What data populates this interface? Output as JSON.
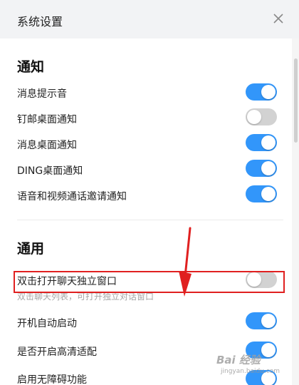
{
  "window": {
    "title": "系统设置"
  },
  "sections": {
    "notify": {
      "title": "通知",
      "items": [
        {
          "label": "消息提示音",
          "on": true
        },
        {
          "label": "钉邮桌面通知",
          "on": false
        },
        {
          "label": "消息桌面通知",
          "on": true
        },
        {
          "label": "DING桌面通知",
          "on": true
        },
        {
          "label": "语音和视频通话邀请通知",
          "on": true
        }
      ]
    },
    "general": {
      "title": "通用",
      "items": [
        {
          "label": "双击打开聊天独立窗口",
          "sub": "双击聊天列表，可打开独立对话窗口",
          "on": false
        },
        {
          "label": "开机自动启动",
          "on": true
        },
        {
          "label": "是否开启高清适配",
          "on": true
        },
        {
          "label": "启用无障碍功能",
          "on": true
        }
      ]
    }
  },
  "colors": {
    "toggle_on": "#3296fa",
    "toggle_off": "#d2d2d2",
    "highlight": "#e02020"
  },
  "icons": {
    "close": "close-icon"
  },
  "watermark": {
    "text": "Bai 经验",
    "sub": "jingyan.baidu.com"
  }
}
